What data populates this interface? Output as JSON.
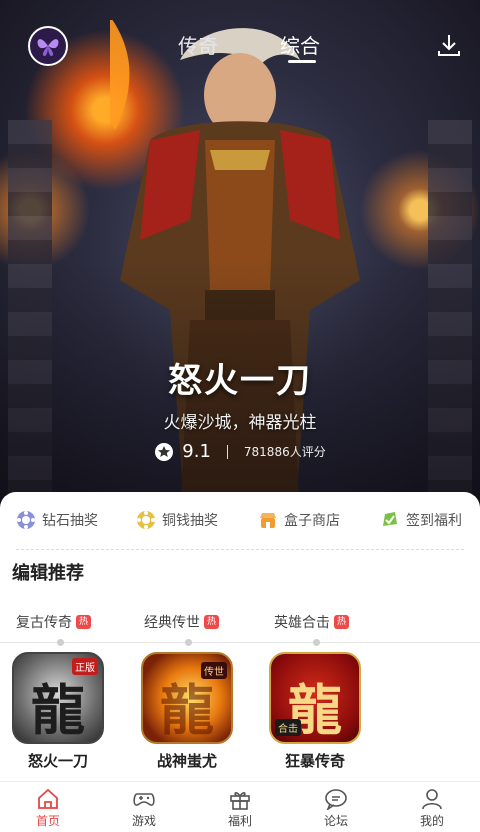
{
  "header": {
    "tabs": [
      {
        "label": "传奇",
        "active": false
      },
      {
        "label": "综合",
        "active": true
      }
    ],
    "icons": [
      "avatar-logo",
      "download-icon"
    ]
  },
  "hero": {
    "title": "怒火一刀",
    "subtitle": "火爆沙城，神器光柱",
    "rating": "9.1",
    "raters": "781886人评分"
  },
  "quick_links": [
    {
      "label": "钻石抽奖",
      "icon": "diamond-icon",
      "color": "#8a8fdc"
    },
    {
      "label": "铜钱抽奖",
      "icon": "coin-icon",
      "color": "#e5c046"
    },
    {
      "label": "盒子商店",
      "icon": "shop-icon",
      "color": "#f29c2f"
    },
    {
      "label": "签到福利",
      "icon": "checkin-icon",
      "color": "#7cc04a"
    }
  ],
  "section": {
    "title": "编辑推荐",
    "categories": [
      {
        "label": "复古传奇",
        "badge": "热"
      },
      {
        "label": "经典传世",
        "badge": "热"
      },
      {
        "label": "英雄合击",
        "badge": "热"
      }
    ]
  },
  "games": [
    {
      "name": "怒火一刀",
      "glyph": "龍",
      "badge": "正版"
    },
    {
      "name": "战神蚩尤",
      "glyph": "龍",
      "badge": "传世"
    },
    {
      "name": "狂暴传奇",
      "glyph": "龍",
      "badge": "合击"
    }
  ],
  "nav": [
    {
      "label": "首页",
      "icon": "home-icon",
      "active": true
    },
    {
      "label": "游戏",
      "icon": "gamepad-icon",
      "active": false
    },
    {
      "label": "福利",
      "icon": "gift-icon",
      "active": false
    },
    {
      "label": "论坛",
      "icon": "forum-icon",
      "active": false
    },
    {
      "label": "我的",
      "icon": "profile-icon",
      "active": false
    }
  ],
  "colors": {
    "accent": "#e54646",
    "hot_badge": "#ef4a4a"
  }
}
